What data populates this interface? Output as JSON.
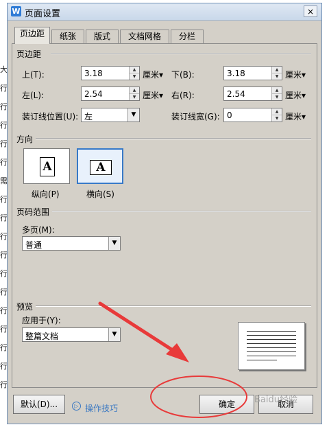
{
  "window": {
    "title": "页面设置",
    "logo": "W",
    "close": "×"
  },
  "background_glyphs": [
    "大",
    "行",
    "行",
    "行",
    "行",
    "行",
    "需",
    "行",
    "行",
    "行",
    "行",
    "行",
    "行",
    "行",
    "行",
    "行",
    "行",
    "行"
  ],
  "tabs": [
    {
      "label": "页边距",
      "active": true
    },
    {
      "label": "纸张"
    },
    {
      "label": "版式"
    },
    {
      "label": "文档网格"
    },
    {
      "label": "分栏"
    }
  ],
  "margins": {
    "section": "页边距",
    "top": {
      "label": "上(T):",
      "value": "3.18",
      "unit": "厘米▾"
    },
    "bottom": {
      "label": "下(B):",
      "value": "3.18",
      "unit": "厘米▾"
    },
    "left": {
      "label": "左(L):",
      "value": "2.54",
      "unit": "厘米▾"
    },
    "right": {
      "label": "右(R):",
      "value": "2.54",
      "unit": "厘米▾"
    },
    "gutter_pos": {
      "label": "装订线位置(U):",
      "value": "左"
    },
    "gutter_width": {
      "label": "装订线宽(G):",
      "value": "0",
      "unit": "厘米▾"
    }
  },
  "orientation": {
    "section": "方向",
    "portrait": {
      "label": "纵向(P)",
      "glyph": "A"
    },
    "landscape": {
      "label": "横向(S)",
      "glyph": "A",
      "selected": true
    }
  },
  "page_range": {
    "section": "页码范围",
    "multi_label": "多页(M):",
    "multi_value": "普通"
  },
  "preview": {
    "section": "预览",
    "apply_label": "应用于(Y):",
    "apply_value": "整篇文档"
  },
  "footer": {
    "default_btn": "默认(D)...",
    "tips": "操作技巧",
    "ok": "确定",
    "cancel": "取消"
  },
  "watermark": "Baidu经验",
  "colors": {
    "annotation": "#e83a3a",
    "link": "#3a78c2"
  }
}
